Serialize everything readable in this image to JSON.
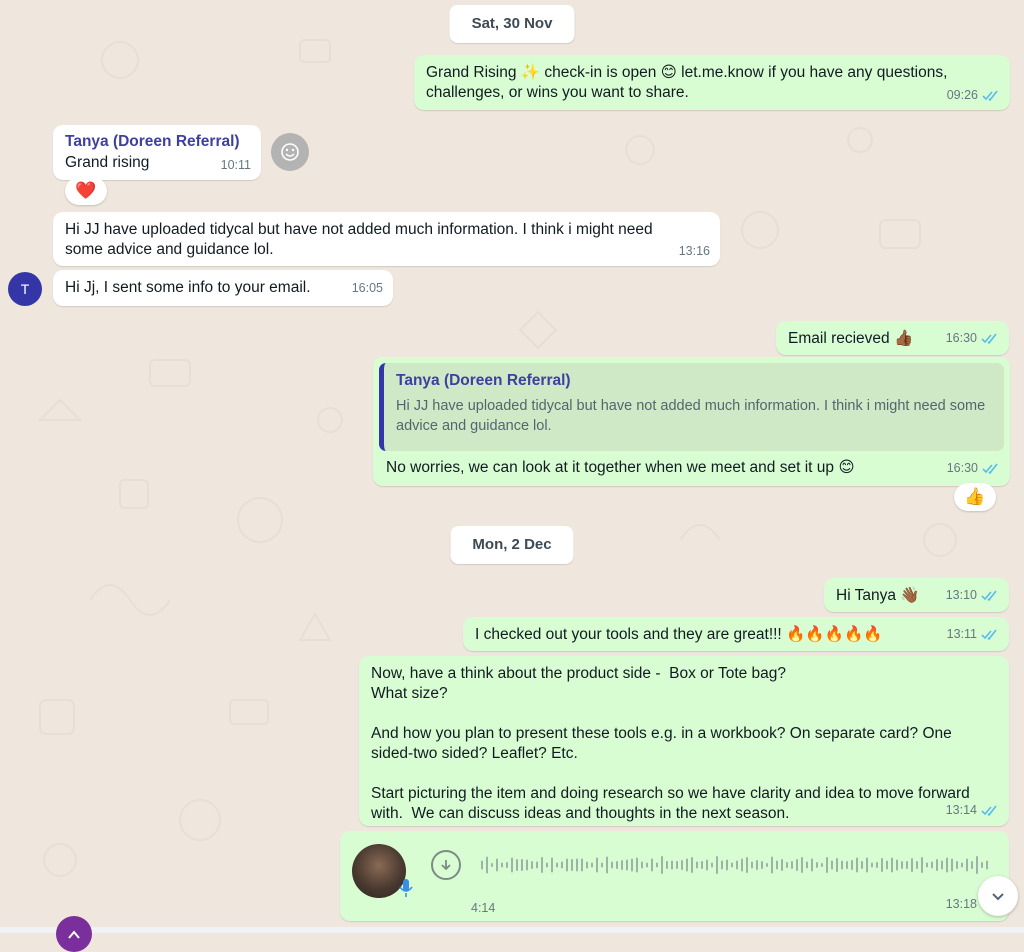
{
  "dates": {
    "first": "Sat, 30 Nov",
    "second": "Mon, 2 Dec"
  },
  "contact": {
    "name": "Tanya (Doreen Referral)",
    "avatar_letter": "T"
  },
  "messages": [
    {
      "dir": "out",
      "text": "Grand Rising ✨ check-in is open 😊 let.me.know if you have any questions, challenges, or wins you want to share.",
      "time": "09:26",
      "status": "read"
    },
    {
      "dir": "in",
      "sender": "Tanya (Doreen Referral)",
      "text": "Grand rising",
      "time": "10:11",
      "reaction": "❤️"
    },
    {
      "dir": "in",
      "text": "Hi JJ have uploaded tidycal  but have not added much information. I think i might need some advice and guidance lol.",
      "time": "13:16"
    },
    {
      "dir": "in",
      "text": "Hi Jj, I sent some info to your email.",
      "time": "16:05"
    },
    {
      "dir": "out",
      "text": "Email recieved 👍🏾",
      "time": "16:30",
      "status": "read"
    },
    {
      "dir": "out",
      "quoted_sender": "Tanya (Doreen Referral)",
      "quoted_text": "Hi JJ have uploaded tidycal  but have not added much information. I think i might need some advice and guidance lol.",
      "text": "No worries, we can look at it together when we meet and set it up 😊",
      "time": "16:30",
      "status": "read",
      "reaction": "👍"
    },
    {
      "dir": "out",
      "text": "Hi Tanya 👋🏾",
      "time": "13:10",
      "status": "read"
    },
    {
      "dir": "out",
      "text": "I checked out your tools and they are great!!! 🔥🔥🔥🔥🔥",
      "time": "13:11",
      "status": "read"
    },
    {
      "dir": "out",
      "text": "Now, have a think about the product side -  Box or Tote bag?\nWhat size?\n\nAnd how you plan to present these tools e.g. in a workbook? On separate card? One sided-two sided? Leaflet? Etc.\n\nStart picturing the item and doing research so we have clarity and idea to move forward with.  We can discuss ideas and thoughts in the next season.",
      "time": "13:14",
      "status": "read"
    },
    {
      "dir": "out",
      "type": "voice",
      "duration": "4:14",
      "time": "13:18",
      "status": "read"
    }
  ],
  "colors": {
    "outgoing": "#d9fdd3",
    "incoming": "#ffffff",
    "read_ticks": "#53bdeb",
    "sender_name": "#3f3fa0",
    "background": "#efe7de"
  },
  "icons": {
    "react": "smiley-icon",
    "scroll": "chevron-down-icon",
    "download": "download-icon",
    "mic": "microphone-icon"
  }
}
